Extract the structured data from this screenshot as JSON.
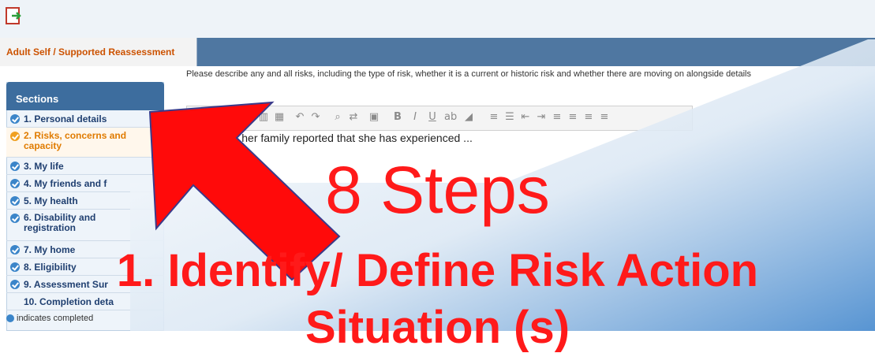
{
  "tab": {
    "label": "Adult Self / Supported Reassessment"
  },
  "sections": {
    "header": "Sections",
    "items": [
      {
        "label": "1.  Personal details",
        "status": "completed"
      },
      {
        "label": "2.  Risks, concerns and capacity",
        "status": "in-progress"
      },
      {
        "label": "3.  My life",
        "status": "completed"
      },
      {
        "label": "4.  My friends and f",
        "status": "completed"
      },
      {
        "label": "5.  My health",
        "status": "completed"
      },
      {
        "label": "6.  Disability and registration",
        "status": "completed"
      },
      {
        "label": "7.  My home",
        "status": "completed"
      },
      {
        "label": "8.  Eligibility",
        "status": "completed"
      },
      {
        "label": "9.  Assessment Sur",
        "status": "completed"
      },
      {
        "label": "10. Completion deta",
        "status": "none"
      }
    ],
    "legend": "indicates completed"
  },
  "prompt": {
    "text": "Please describe any and all risks, including the type of risk, whether it is a current or historic risk and whether there are moving on alongside details"
  },
  "editor": {
    "content": "…of falls, her family reported that she has experienced ..."
  },
  "overlay": {
    "title": "8 Steps",
    "line1": "1. Identify/ Define Risk Action",
    "line2": "Situation (s)"
  },
  "colors": {
    "accent_red": "#ff1a1a",
    "header_blue": "#3d6d9e",
    "tab_orange": "#cc5200"
  },
  "icons": {
    "doc": "document-export-icon",
    "arrow": "red-arrow-pointer",
    "check": "check-circle-icon"
  }
}
